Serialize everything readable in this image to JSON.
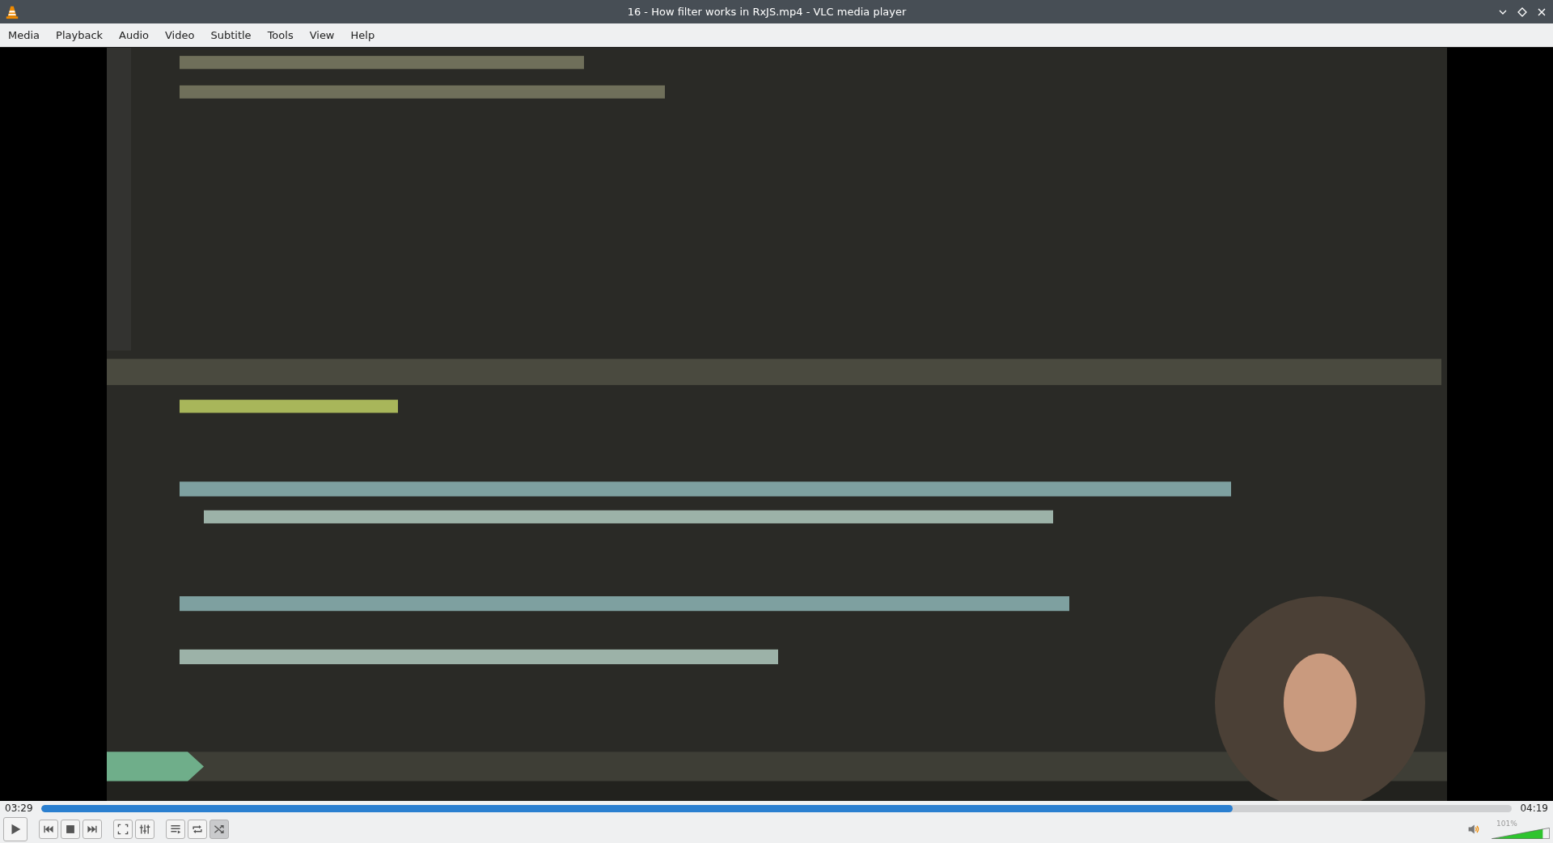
{
  "window": {
    "title": "16 - How filter works in RxJS.mp4 - VLC media player"
  },
  "menu": [
    "Media",
    "Playback",
    "Audio",
    "Video",
    "Subtitle",
    "Tools",
    "View",
    "Help"
  ],
  "video": {
    "kind": "picture"
  },
  "seek": {
    "elapsed": "03:29",
    "total": "04:19",
    "level": 0.81
  },
  "controls": [
    {
      "kind": "play",
      "on": false
    },
    {
      "kind": "previous",
      "on": false
    },
    {
      "kind": "stop",
      "on": false
    },
    {
      "kind": "next",
      "on": false
    },
    {
      "kind": "fullscreen",
      "on": false
    },
    {
      "kind": "effects",
      "on": false
    },
    {
      "kind": "playlist",
      "on": false
    },
    {
      "kind": "loop",
      "on": false
    },
    {
      "kind": "shuffle",
      "on": true
    }
  ],
  "volume": {
    "reading": "101%",
    "level": 0.88
  }
}
